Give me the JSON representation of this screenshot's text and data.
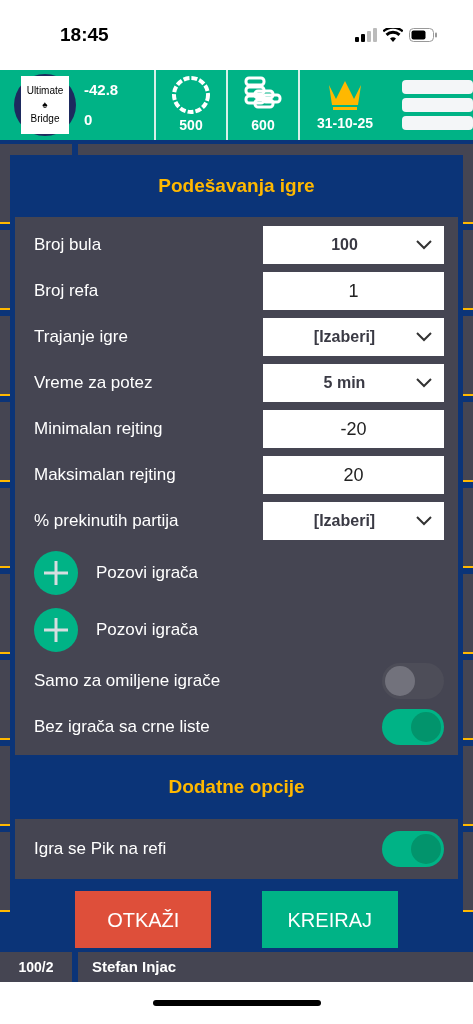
{
  "status_bar": {
    "time": "18:45"
  },
  "header": {
    "logo": [
      "Ultimate",
      "♠",
      "Bridge"
    ],
    "rating": "-42.8",
    "score": "0",
    "chips": "500",
    "coins": "600",
    "date": "31-10-25"
  },
  "background": {
    "row_count": "100/2",
    "player": "Stefan Injac"
  },
  "dialog": {
    "title": "Podešavanja igre",
    "rows": [
      {
        "kind": "select",
        "label": "Broj bula",
        "value": "100"
      },
      {
        "kind": "input",
        "label": "Broj refa",
        "value": "1"
      },
      {
        "kind": "select",
        "label": "Trajanje igre",
        "value": "[Izaberi]"
      },
      {
        "kind": "select",
        "label": "Vreme za potez",
        "value": "5 min"
      },
      {
        "kind": "input",
        "label": "Minimalan rejting",
        "value": "-20"
      },
      {
        "kind": "input",
        "label": "Maksimalan rejting",
        "value": "20"
      },
      {
        "kind": "select",
        "label": "% prekinutih partija",
        "value": "[Izaberi]"
      },
      {
        "kind": "invite",
        "label": "Pozovi igrača"
      },
      {
        "kind": "invite",
        "label": "Pozovi igrača"
      },
      {
        "kind": "toggle",
        "label": "Samo za omiljene igrače",
        "on": false
      },
      {
        "kind": "toggle",
        "label": "Bez igrača sa crne liste",
        "on": true
      }
    ],
    "extra_title": "Dodatne opcije",
    "extra_rows": [
      {
        "kind": "toggle",
        "label": "Igra se Pik na refi",
        "on": true
      }
    ],
    "buttons": [
      {
        "kind": "cancel",
        "label": "OTKAŽI"
      },
      {
        "kind": "confirm",
        "label": "KREIRAJ"
      }
    ]
  }
}
